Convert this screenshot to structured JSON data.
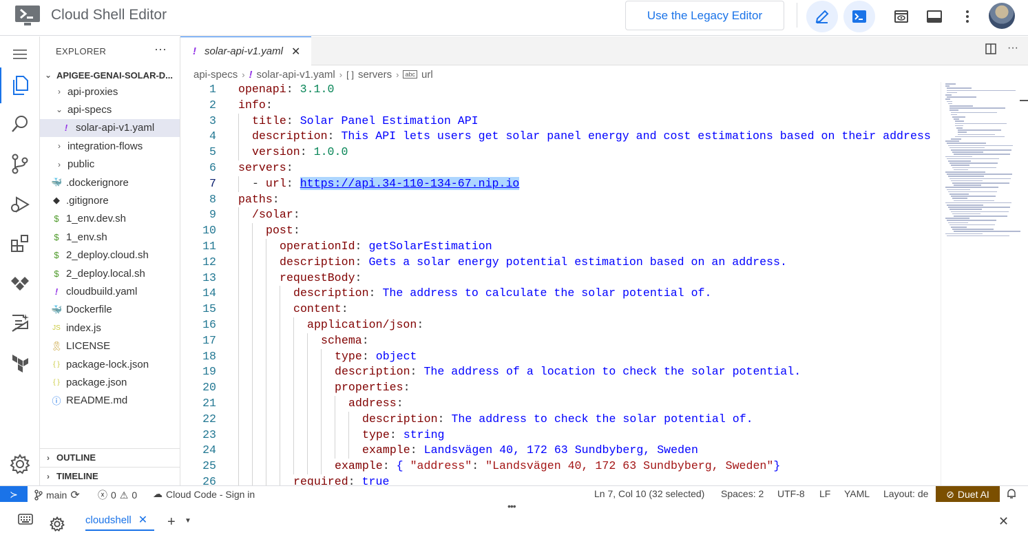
{
  "app": {
    "title": "Cloud Shell Editor",
    "legacy_button": "Use the Legacy Editor"
  },
  "explorer": {
    "header": "EXPLORER",
    "root": "APIGEE-GENAI-SOLAR-D...",
    "items": [
      {
        "label": "api-proxies",
        "kind": "folder",
        "expanded": false,
        "depth": 1
      },
      {
        "label": "api-specs",
        "kind": "folder",
        "expanded": true,
        "depth": 1
      },
      {
        "label": "solar-api-v1.yaml",
        "kind": "yaml",
        "depth": 2,
        "selected": true
      },
      {
        "label": "integration-flows",
        "kind": "folder",
        "expanded": false,
        "depth": 1
      },
      {
        "label": "public",
        "kind": "folder",
        "expanded": false,
        "depth": 1
      },
      {
        "label": ".dockerignore",
        "kind": "docker",
        "depth": 1
      },
      {
        "label": ".gitignore",
        "kind": "git",
        "depth": 1
      },
      {
        "label": "1_env.dev.sh",
        "kind": "sh",
        "depth": 1
      },
      {
        "label": "1_env.sh",
        "kind": "sh",
        "depth": 1
      },
      {
        "label": "2_deploy.cloud.sh",
        "kind": "sh",
        "depth": 1
      },
      {
        "label": "2_deploy.local.sh",
        "kind": "sh",
        "depth": 1
      },
      {
        "label": "cloudbuild.yaml",
        "kind": "yaml",
        "depth": 1
      },
      {
        "label": "Dockerfile",
        "kind": "docker",
        "depth": 1
      },
      {
        "label": "index.js",
        "kind": "js",
        "depth": 1
      },
      {
        "label": "LICENSE",
        "kind": "license",
        "depth": 1
      },
      {
        "label": "package-lock.json",
        "kind": "json",
        "depth": 1
      },
      {
        "label": "package.json",
        "kind": "json",
        "depth": 1
      },
      {
        "label": "README.md",
        "kind": "info",
        "depth": 1
      }
    ],
    "sections": [
      "OUTLINE",
      "TIMELINE"
    ]
  },
  "editor": {
    "tab": {
      "label": "solar-api-v1.yaml",
      "icon": "!"
    },
    "breadcrumb": [
      "api-specs",
      "solar-api-v1.yaml",
      "servers",
      "url"
    ],
    "current_line": 7,
    "lines": [
      {
        "n": "1",
        "indent": 0,
        "tokens": [
          [
            "k",
            "openapi"
          ],
          [
            "p",
            ": "
          ],
          [
            "n",
            "3.1.0"
          ]
        ]
      },
      {
        "n": "2",
        "indent": 0,
        "tokens": [
          [
            "k",
            "info"
          ],
          [
            "p",
            ":"
          ]
        ]
      },
      {
        "n": "3",
        "indent": 1,
        "tokens": [
          [
            "k",
            "title"
          ],
          [
            "p",
            ": "
          ],
          [
            "s",
            "Solar Panel Estimation API"
          ]
        ]
      },
      {
        "n": "4",
        "indent": 1,
        "tokens": [
          [
            "k",
            "description"
          ],
          [
            "p",
            ": "
          ],
          [
            "s",
            "This API lets users get solar panel energy and cost estimations based on their address"
          ]
        ]
      },
      {
        "n": "5",
        "indent": 1,
        "tokens": [
          [
            "k",
            "version"
          ],
          [
            "p",
            ": "
          ],
          [
            "n",
            "1.0.0"
          ]
        ]
      },
      {
        "n": "6",
        "indent": 0,
        "tokens": [
          [
            "k",
            "servers"
          ],
          [
            "p",
            ":"
          ]
        ]
      },
      {
        "n": "7",
        "indent": 1,
        "tokens": [
          [
            "p",
            "- "
          ],
          [
            "k",
            "url"
          ],
          [
            "p",
            ": "
          ],
          [
            "sel",
            "https://api.34-110-134-67.nip.io"
          ]
        ]
      },
      {
        "n": "8",
        "indent": 0,
        "tokens": [
          [
            "k",
            "paths"
          ],
          [
            "p",
            ":"
          ]
        ]
      },
      {
        "n": "9",
        "indent": 1,
        "tokens": [
          [
            "k",
            "/solar"
          ],
          [
            "p",
            ":"
          ]
        ]
      },
      {
        "n": "10",
        "indent": 2,
        "tokens": [
          [
            "k",
            "post"
          ],
          [
            "p",
            ":"
          ]
        ]
      },
      {
        "n": "11",
        "indent": 3,
        "tokens": [
          [
            "k",
            "operationId"
          ],
          [
            "p",
            ": "
          ],
          [
            "s",
            "getSolarEstimation"
          ]
        ]
      },
      {
        "n": "12",
        "indent": 3,
        "tokens": [
          [
            "k",
            "description"
          ],
          [
            "p",
            ": "
          ],
          [
            "s",
            "Gets a solar energy potential estimation based on an address."
          ]
        ]
      },
      {
        "n": "13",
        "indent": 3,
        "tokens": [
          [
            "k",
            "requestBody"
          ],
          [
            "p",
            ":"
          ]
        ]
      },
      {
        "n": "14",
        "indent": 4,
        "tokens": [
          [
            "k",
            "description"
          ],
          [
            "p",
            ": "
          ],
          [
            "s",
            "The address to calculate the solar potential of."
          ]
        ]
      },
      {
        "n": "15",
        "indent": 4,
        "tokens": [
          [
            "k",
            "content"
          ],
          [
            "p",
            ":"
          ]
        ]
      },
      {
        "n": "16",
        "indent": 5,
        "tokens": [
          [
            "k",
            "application/json"
          ],
          [
            "p",
            ":"
          ]
        ]
      },
      {
        "n": "17",
        "indent": 6,
        "tokens": [
          [
            "k",
            "schema"
          ],
          [
            "p",
            ":"
          ]
        ]
      },
      {
        "n": "18",
        "indent": 7,
        "tokens": [
          [
            "k",
            "type"
          ],
          [
            "p",
            ": "
          ],
          [
            "s",
            "object"
          ]
        ]
      },
      {
        "n": "19",
        "indent": 7,
        "tokens": [
          [
            "k",
            "description"
          ],
          [
            "p",
            ": "
          ],
          [
            "s",
            "The address of a location to check the solar potential."
          ]
        ]
      },
      {
        "n": "20",
        "indent": 7,
        "tokens": [
          [
            "k",
            "properties"
          ],
          [
            "p",
            ":"
          ]
        ]
      },
      {
        "n": "21",
        "indent": 8,
        "tokens": [
          [
            "k",
            "address"
          ],
          [
            "p",
            ":"
          ]
        ]
      },
      {
        "n": "22",
        "indent": 9,
        "tokens": [
          [
            "k",
            "description"
          ],
          [
            "p",
            ": "
          ],
          [
            "s",
            "The address to check the solar potential of."
          ]
        ]
      },
      {
        "n": "23",
        "indent": 9,
        "tokens": [
          [
            "k",
            "type"
          ],
          [
            "p",
            ": "
          ],
          [
            "s",
            "string"
          ]
        ]
      },
      {
        "n": "24",
        "indent": 9,
        "tokens": [
          [
            "k",
            "example"
          ],
          [
            "p",
            ": "
          ],
          [
            "s",
            "Landsvägen 40, 172 63 Sundbyberg, Sweden"
          ]
        ]
      },
      {
        "n": "25",
        "indent": 7,
        "tokens": [
          [
            "k",
            "example"
          ],
          [
            "p",
            ": "
          ],
          [
            "s",
            "{ "
          ],
          [
            "q",
            "\"address\""
          ],
          [
            "p",
            ": "
          ],
          [
            "q",
            "\"Landsvägen 40, 172 63 Sundbyberg, Sweden\""
          ],
          [
            "s",
            "}"
          ]
        ]
      },
      {
        "n": "26",
        "indent": 4,
        "tokens": [
          [
            "k",
            "required"
          ],
          [
            "p",
            ": "
          ],
          [
            "s",
            "true"
          ]
        ]
      }
    ]
  },
  "status": {
    "branch": "main",
    "errors": "0",
    "warnings": "0",
    "cloud_code": "Cloud Code - Sign in",
    "cursor": "Ln 7, Col 10 (32 selected)",
    "spaces": "Spaces: 2",
    "encoding": "UTF-8",
    "eol": "LF",
    "language": "YAML",
    "layout": "Layout: de",
    "duet": "Duet AI"
  },
  "terminal": {
    "tab_label": "cloudshell"
  },
  "colors": {
    "accent": "#1a73e8",
    "key": "#800000",
    "string": "#0000ff",
    "number": "#098658",
    "duet": "#7b4f00"
  }
}
